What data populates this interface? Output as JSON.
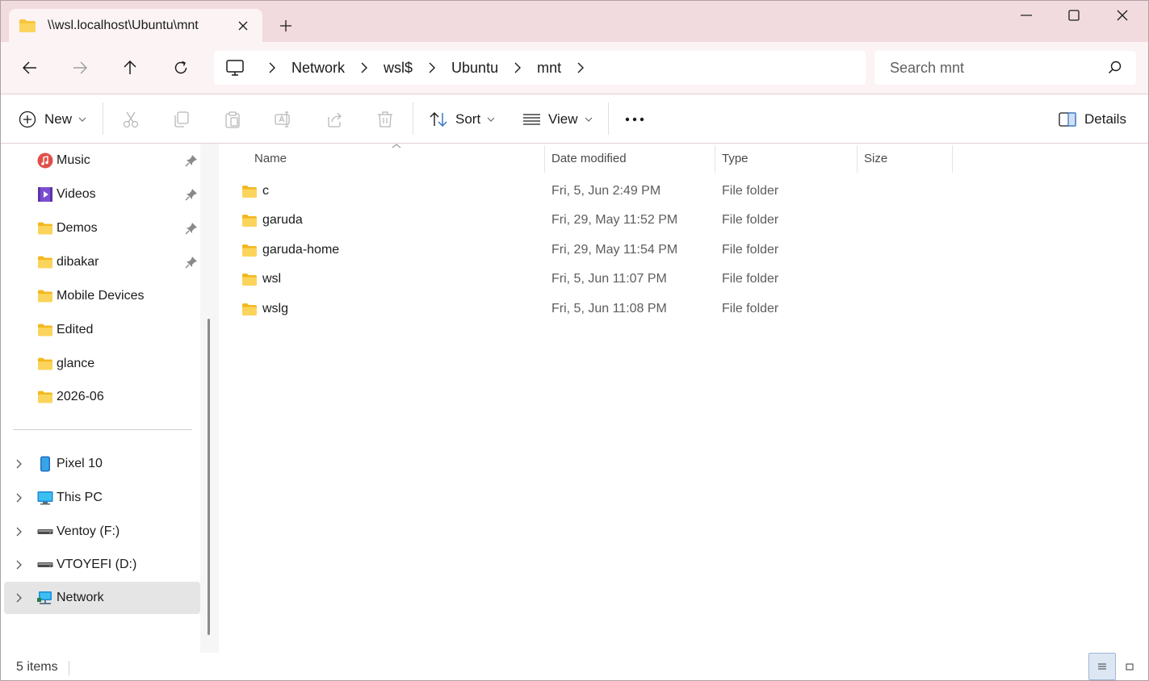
{
  "tab": {
    "title": "\\\\wsl.localhost\\Ubuntu\\mnt"
  },
  "address": {
    "crumbs": [
      "Network",
      "wsl$",
      "Ubuntu",
      "mnt"
    ]
  },
  "search": {
    "placeholder": "Search mnt"
  },
  "toolbar": {
    "new_label": "New",
    "sort_label": "Sort",
    "view_label": "View",
    "details_label": "Details"
  },
  "nav": {
    "quick_access": [
      {
        "label": "Music",
        "icon": "music-icon",
        "pinned": true
      },
      {
        "label": "Videos",
        "icon": "videos-icon",
        "pinned": true
      },
      {
        "label": "Demos",
        "icon": "folder-icon",
        "pinned": true
      },
      {
        "label": "dibakar",
        "icon": "folder-icon",
        "pinned": true
      },
      {
        "label": "Mobile Devices",
        "icon": "folder-icon",
        "pinned": false
      },
      {
        "label": "Edited",
        "icon": "folder-icon",
        "pinned": false
      },
      {
        "label": "glance",
        "icon": "folder-icon",
        "pinned": false
      },
      {
        "label": "2026-06",
        "icon": "folder-icon",
        "pinned": false
      }
    ],
    "locations": [
      {
        "label": "Pixel 10",
        "icon": "phone-icon"
      },
      {
        "label": "This PC",
        "icon": "this-pc-icon"
      },
      {
        "label": "Ventoy (F:)",
        "icon": "drive-icon"
      },
      {
        "label": "VTOYEFI (D:)",
        "icon": "drive-icon"
      },
      {
        "label": "Network",
        "icon": "network-icon",
        "selected": true
      }
    ]
  },
  "columns": {
    "name": "Name",
    "date": "Date modified",
    "type": "Type",
    "size": "Size"
  },
  "files": [
    {
      "name": "c",
      "date": "Fri, 5, Jun 2:49 PM",
      "type": "File folder",
      "size": ""
    },
    {
      "name": "garuda",
      "date": "Fri, 29, May 11:52 PM",
      "type": "File folder",
      "size": ""
    },
    {
      "name": "garuda-home",
      "date": "Fri, 29, May 11:54 PM",
      "type": "File folder",
      "size": ""
    },
    {
      "name": "wsl",
      "date": "Fri, 5, Jun 11:07 PM",
      "type": "File folder",
      "size": ""
    },
    {
      "name": "wslg",
      "date": "Fri, 5, Jun 11:08 PM",
      "type": "File folder",
      "size": ""
    }
  ],
  "status": {
    "item_count": "5 items"
  },
  "colors": {
    "titlebar": "#f1dbdf",
    "navbar": "#fbf3f4",
    "folder": "#f8c63a",
    "selected": "#e5e5e5"
  }
}
